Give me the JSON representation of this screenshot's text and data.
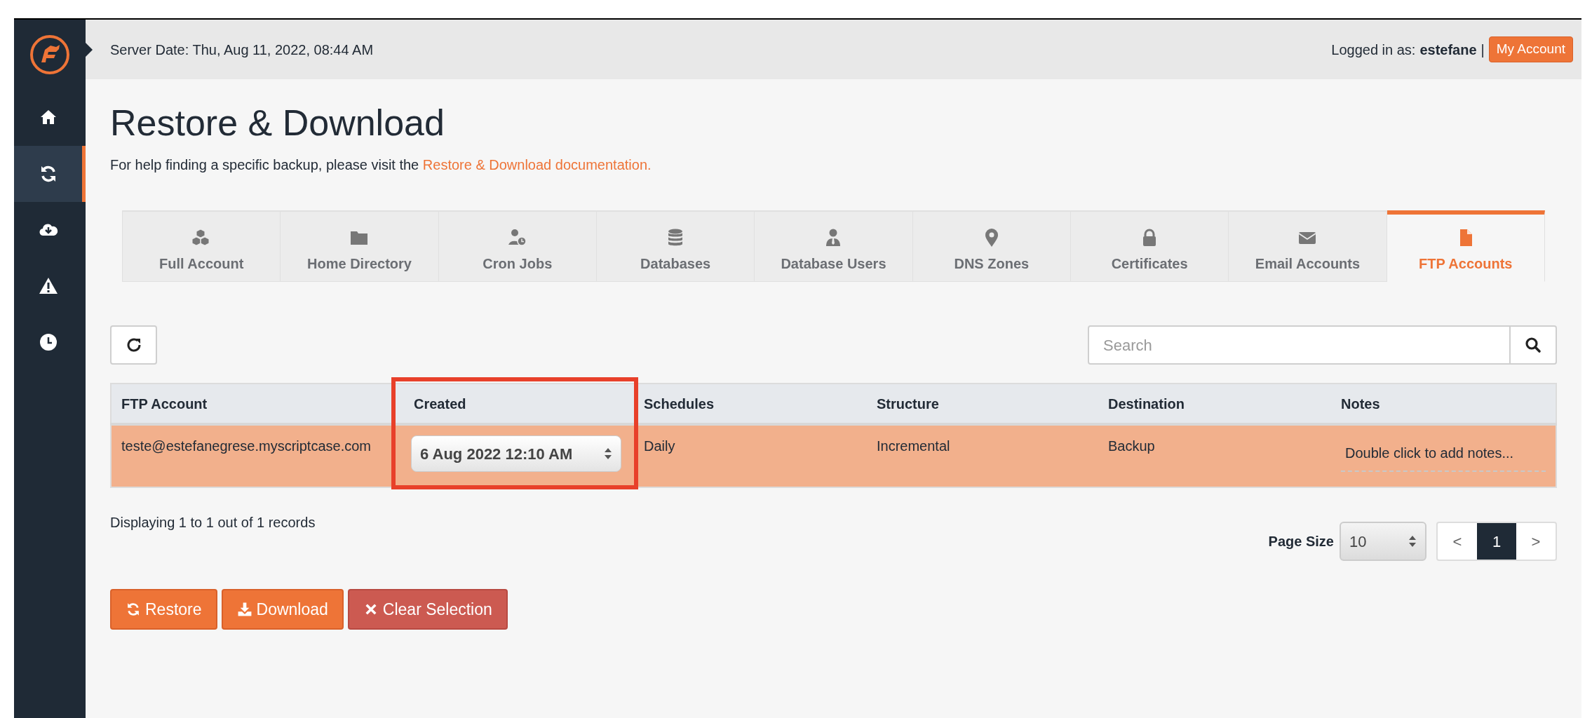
{
  "sidebar": {
    "items": [
      {
        "selected": false
      },
      {
        "selected": true
      },
      {
        "selected": false
      },
      {
        "selected": false
      },
      {
        "selected": false
      }
    ]
  },
  "header": {
    "server_date": "Server Date: Thu, Aug 11, 2022, 08:44 AM",
    "logged_in_label": "Logged in as:",
    "username": "estefane",
    "separator": "|",
    "account_button": "My Account"
  },
  "page": {
    "title": "Restore & Download",
    "help_text": "For help finding a specific backup, please visit the",
    "help_link": "Restore & Download documentation."
  },
  "tabs": [
    {
      "label": "Full Account",
      "selected": false
    },
    {
      "label": "Home Directory",
      "selected": false
    },
    {
      "label": "Cron Jobs",
      "selected": false
    },
    {
      "label": "Databases",
      "selected": false
    },
    {
      "label": "Database Users",
      "selected": false
    },
    {
      "label": "DNS Zones",
      "selected": false
    },
    {
      "label": "Certificates",
      "selected": false
    },
    {
      "label": "Email Accounts",
      "selected": false
    },
    {
      "label": "FTP Accounts",
      "selected": true
    }
  ],
  "search": {
    "placeholder": "Search"
  },
  "table": {
    "columns": [
      {
        "label": "FTP Account",
        "highlighted": false
      },
      {
        "label": "Created",
        "highlighted": true
      },
      {
        "label": "Schedules",
        "highlighted": false
      },
      {
        "label": "Structure",
        "highlighted": false
      },
      {
        "label": "Destination",
        "highlighted": false
      },
      {
        "label": "Notes",
        "highlighted": false
      }
    ],
    "rows": [
      {
        "selected": true,
        "account": "teste@estefanegrese.myscriptcase.com",
        "created": "6 Aug 2022 12:10 AM",
        "schedule": "Daily",
        "structure": "Incremental",
        "destination": "Backup",
        "notes": "Double click to add notes..."
      }
    ]
  },
  "footer": {
    "records": "Displaying 1 to 1 out of 1 records",
    "page_size_label": "Page Size",
    "page_size": "10",
    "prev": "<",
    "pages": [
      {
        "label": "1",
        "selected": true
      }
    ],
    "next": ">"
  },
  "actions": [
    {
      "kind": "restore",
      "label": "Restore"
    },
    {
      "kind": "download",
      "label": "Download"
    },
    {
      "kind": "clear",
      "label": "Clear Selection"
    }
  ]
}
